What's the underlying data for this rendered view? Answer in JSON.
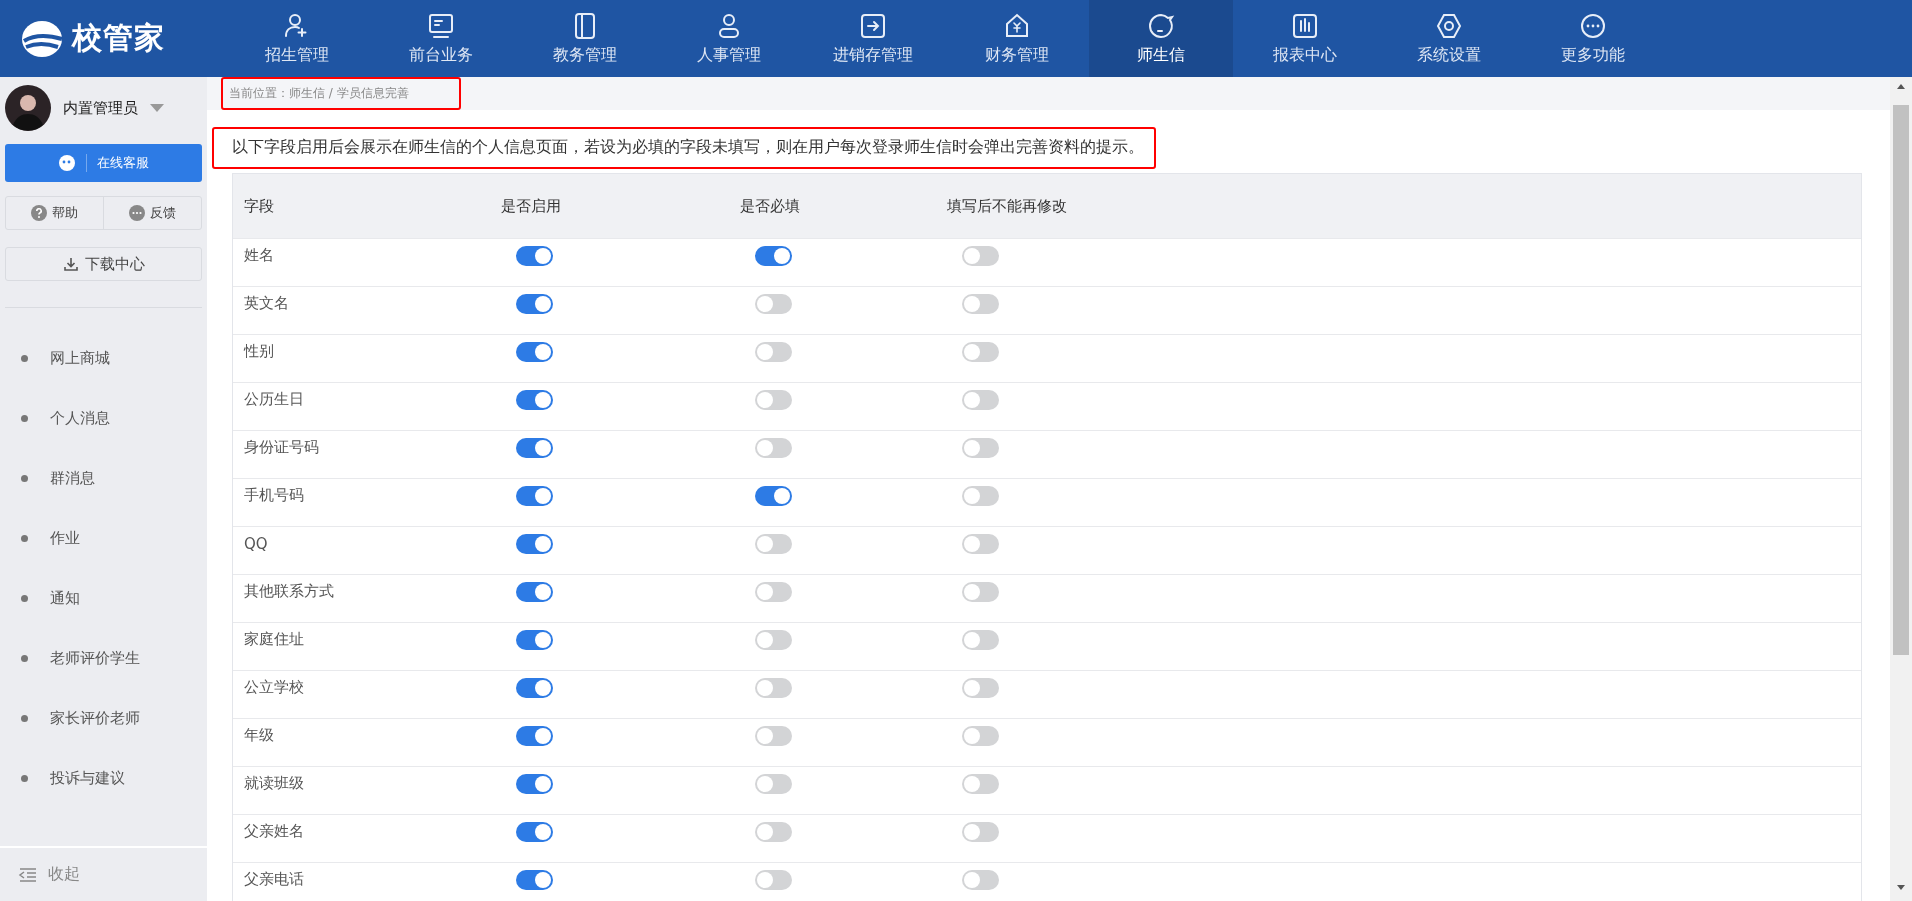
{
  "logo": {
    "text": "校管家"
  },
  "nav": [
    {
      "label": "招生管理",
      "selected": false
    },
    {
      "label": "前台业务",
      "selected": false
    },
    {
      "label": "教务管理",
      "selected": false
    },
    {
      "label": "人事管理",
      "selected": false
    },
    {
      "label": "进销存管理",
      "selected": false
    },
    {
      "label": "财务管理",
      "selected": false
    },
    {
      "label": "师生信",
      "selected": true
    },
    {
      "label": "报表中心",
      "selected": false
    },
    {
      "label": "系统设置",
      "selected": false
    },
    {
      "label": "更多功能",
      "selected": false
    }
  ],
  "sidebar": {
    "user": "内置管理员",
    "service_button": "在线客服",
    "help": "帮助",
    "feedback": "反馈",
    "download": "下载中心",
    "items": [
      "网上商城",
      "个人消息",
      "群消息",
      "作业",
      "通知",
      "老师评价学生",
      "家长评价老师",
      "投诉与建议"
    ],
    "collapse": "收起"
  },
  "breadcrumb": "当前位置：师生信 / 学员信息完善",
  "notice": "以下字段启用后会展示在师生信的个人信息页面，若设为必填的字段未填写，则在用户每次登录师生信时会弹出完善资料的提示。",
  "table": {
    "columns": [
      "字段",
      "是否启用",
      "是否必填",
      "填写后不能再修改"
    ],
    "rows": [
      {
        "field": "姓名",
        "enabled": true,
        "required": true,
        "locked": false
      },
      {
        "field": "英文名",
        "enabled": true,
        "required": false,
        "locked": false
      },
      {
        "field": "性别",
        "enabled": true,
        "required": false,
        "locked": false
      },
      {
        "field": "公历生日",
        "enabled": true,
        "required": false,
        "locked": false
      },
      {
        "field": "身份证号码",
        "enabled": true,
        "required": false,
        "locked": false
      },
      {
        "field": "手机号码",
        "enabled": true,
        "required": true,
        "locked": false
      },
      {
        "field": "QQ",
        "enabled": true,
        "required": false,
        "locked": false
      },
      {
        "field": "其他联系方式",
        "enabled": true,
        "required": false,
        "locked": false
      },
      {
        "field": "家庭住址",
        "enabled": true,
        "required": false,
        "locked": false
      },
      {
        "field": "公立学校",
        "enabled": true,
        "required": false,
        "locked": false
      },
      {
        "field": "年级",
        "enabled": true,
        "required": false,
        "locked": false
      },
      {
        "field": "就读班级",
        "enabled": true,
        "required": false,
        "locked": false
      },
      {
        "field": "父亲姓名",
        "enabled": true,
        "required": false,
        "locked": false
      },
      {
        "field": "父亲电话",
        "enabled": true,
        "required": false,
        "locked": false
      }
    ]
  }
}
